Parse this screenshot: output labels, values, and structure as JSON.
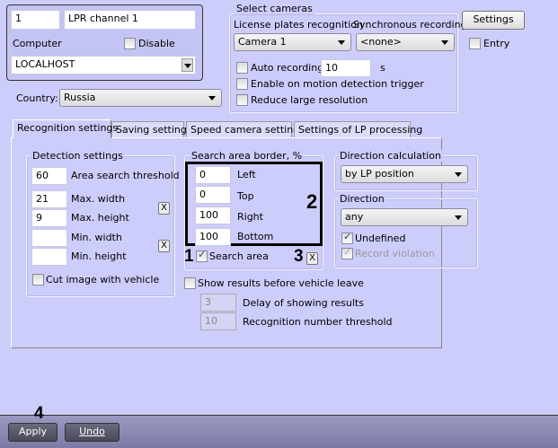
{
  "channel": {
    "id": "1",
    "name": "LPR channel 1",
    "computer_label": "Computer",
    "disable_label": "Disable",
    "computer_value": "LOCALHOST"
  },
  "country": {
    "label": "Country:",
    "value": "Russia"
  },
  "cameras": {
    "legend": "Select cameras",
    "lpr_label": "License plates recognition",
    "sync_label": "Synchronous recording",
    "lpr_value": "Camera 1",
    "sync_value": "<none>",
    "auto_recording": "Auto recording",
    "auto_value": "10",
    "seconds": "s",
    "motion": "Enable on motion detection trigger",
    "reduce": "Reduce large resolution"
  },
  "settings_button": "Settings",
  "entry_label": "Entry",
  "tabs": [
    "Recognition settings",
    "Saving settings",
    "Speed camera settings",
    "Settings of LP processing"
  ],
  "detection": {
    "legend": "Detection settings",
    "rows": [
      {
        "value": "60",
        "label": "Area search threshold"
      },
      {
        "value": "21",
        "label": "Max. width"
      },
      {
        "value": "9",
        "label": "Max. height"
      },
      {
        "value": "",
        "label": "Min. width"
      },
      {
        "value": "",
        "label": "Min. height"
      }
    ],
    "clear": "X",
    "cut_image": "Cut image with vehicle"
  },
  "search_area": {
    "legend": "Search area border, %",
    "rows": [
      {
        "value": "0",
        "label": "Left"
      },
      {
        "value": "0",
        "label": "Top"
      },
      {
        "value": "100",
        "label": "Right"
      },
      {
        "value": "100",
        "label": "Bottom"
      }
    ],
    "checkbox": "Search area",
    "clear": "X"
  },
  "show_results": {
    "label": "Show results before vehicle leave",
    "delay_value": "3",
    "delay_label": "Delay of showing results",
    "threshold_value": "10",
    "threshold_label": "Recognition number threshold"
  },
  "direction_calc": {
    "legend": "Direction calculation",
    "value": "by LP position"
  },
  "direction": {
    "legend": "Direction",
    "value": "any",
    "undefined": "Undefined",
    "record_violation": "Record violation"
  },
  "annotations": [
    "1",
    "2",
    "3",
    "4"
  ],
  "footer": {
    "apply": "Apply",
    "undo": "Undo"
  }
}
